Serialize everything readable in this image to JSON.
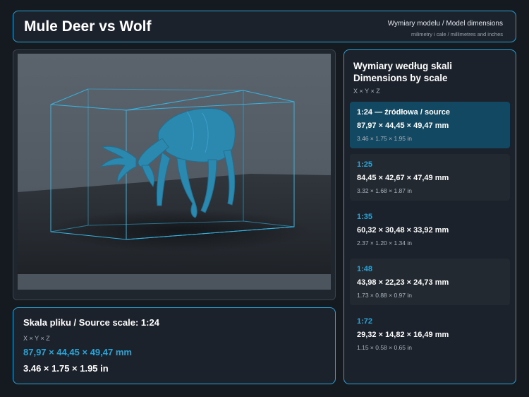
{
  "header": {
    "title": "Mule Deer vs Wolf",
    "subtitle": "Wymiary modelu / Model dimensions",
    "units": "milimetry i cale / millimetres and inches"
  },
  "source": {
    "heading": "Skala pliku / Source scale: 1:24",
    "axes": "X × Y × Z",
    "mm": "87,97 × 44,45 × 49,47 mm",
    "inch": "3.46 × 1.75 × 1.95 in"
  },
  "scales": {
    "title_pl": "Wymiary według skali",
    "title_en": "Dimensions by scale",
    "axes": "X × Y × Z",
    "items": [
      {
        "ratio": "1:24  —  źródłowa / source",
        "mm": "87,97 × 44,45 × 49,47 mm",
        "inch": "3.46 × 1.75 × 1.95 in"
      },
      {
        "ratio": "1:25",
        "mm": "84,45 × 42,67 × 47,49 mm",
        "inch": "3.32 × 1.68 × 1.87 in"
      },
      {
        "ratio": "1:35",
        "mm": "60,32 × 30,48 × 33,92 mm",
        "inch": "2.37 × 1.20 × 1.34 in"
      },
      {
        "ratio": "1:48",
        "mm": "43,98 × 22,23 × 24,73 mm",
        "inch": "1.73 × 0.88 × 0.97 in"
      },
      {
        "ratio": "1:72",
        "mm": "29,32 × 14,82 × 16,49 mm",
        "inch": "1.15 × 0.58 × 0.65 in"
      }
    ]
  },
  "colors": {
    "accent": "#2aa3d6",
    "highlight": "#124862",
    "background": "#151a21"
  }
}
